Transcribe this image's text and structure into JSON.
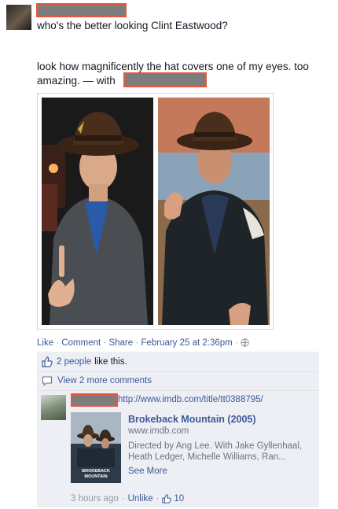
{
  "post": {
    "line1": "who's the better looking Clint Eastwood?",
    "line2": "look how magnificently the hat covers one of my eyes. too",
    "line3_prefix": "amazing. — with"
  },
  "actions": {
    "like": "Like",
    "comment": "Comment",
    "share": "Share",
    "timestamp": "February 25 at 2:36pm",
    "dot": "·",
    "audience_icon": "globe-icon"
  },
  "likes": {
    "count_text": "2 people",
    "suffix": "like this.",
    "icon": "thumbs-up-icon"
  },
  "comments": {
    "view_more": "View 2 more comments",
    "icon": "comment-icon"
  },
  "comment": {
    "url": "http://www.imdb.com/title/tt0388795/",
    "preview": {
      "title": "Brokeback Mountain (2005)",
      "domain": "www.imdb.com",
      "desc1": "Directed by Ang Lee. With Jake Gyllenhaal,",
      "desc2": "Heath Ledger, Michelle Williams, Ran...",
      "see_more": "See More",
      "poster_text": "BROKEBACK\nMOUNTAIN"
    },
    "time": "3 hours ago",
    "unlike": "Unlike",
    "like_count": "10"
  },
  "colors": {
    "link": "#3b5998",
    "redaction_border": "#e8553b",
    "ufi_bg": "#edeff4"
  }
}
